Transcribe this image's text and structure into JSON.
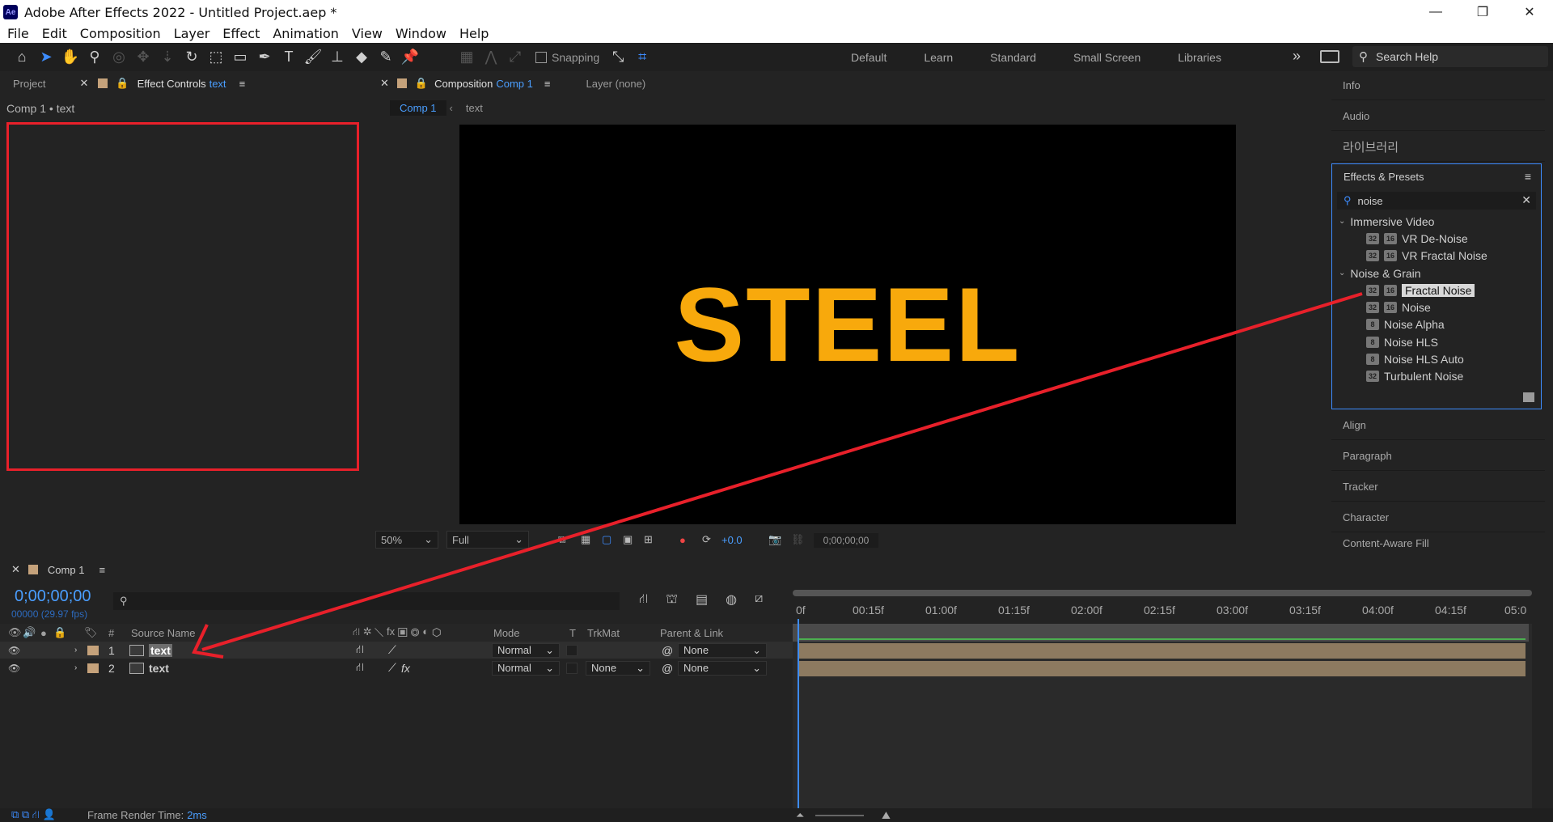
{
  "window": {
    "title": "Adobe After Effects 2022 - Untitled Project.aep *",
    "logo": "Ae",
    "minimize": "—",
    "restore": "❐",
    "close": "✕"
  },
  "menu": [
    "File",
    "Edit",
    "Composition",
    "Layer",
    "Effect",
    "Animation",
    "View",
    "Window",
    "Help"
  ],
  "toolbar": {
    "snapping_label": "Snapping",
    "workspaces": [
      "Default",
      "Learn",
      "Standard",
      "Small Screen",
      "Libraries"
    ],
    "search_help": "Search Help"
  },
  "left_panel": {
    "tab_project": "Project",
    "tab_effect_controls": "Effect Controls",
    "tab_effect_controls_target": "text",
    "breadcrumb": "Comp 1 • text"
  },
  "composition": {
    "tab_label": "Composition",
    "tab_comp": "Comp 1",
    "layer_tab": "Layer (none)",
    "subtab_comp": "Comp 1",
    "subtab_layer": "text",
    "canvas_text": "STEEL",
    "zoom": "50%",
    "resolution": "Full",
    "exposure": "+0.0",
    "timecode": "0;00;00;00"
  },
  "right_panel": {
    "info": "Info",
    "audio": "Audio",
    "library": "라이브러리",
    "effects_presets": "Effects & Presets",
    "search_value": "noise",
    "categories": [
      {
        "name": "Immersive Video",
        "items": [
          {
            "label": "VR De-Noise",
            "badges": [
              "32",
              "16"
            ]
          },
          {
            "label": "VR Fractal Noise",
            "badges": [
              "32",
              "16"
            ]
          }
        ]
      },
      {
        "name": "Noise & Grain",
        "items": [
          {
            "label": "Fractal Noise",
            "badges": [
              "32",
              "16"
            ]
          },
          {
            "label": "Noise",
            "badges": [
              "32",
              "16"
            ]
          },
          {
            "label": "Noise Alpha",
            "badges": [
              "8"
            ]
          },
          {
            "label": "Noise HLS",
            "badges": [
              "8"
            ]
          },
          {
            "label": "Noise HLS Auto",
            "badges": [
              "8"
            ]
          },
          {
            "label": "Turbulent Noise",
            "badges": [
              "32"
            ]
          }
        ]
      }
    ],
    "align": "Align",
    "paragraph": "Paragraph",
    "tracker": "Tracker",
    "character": "Character",
    "content_aware": "Content-Aware Fill"
  },
  "timeline": {
    "tab": "Comp 1",
    "timecode": "0;00;00;00",
    "timecode_sub": "00000 (29.97 fps)",
    "columns": {
      "hash": "#",
      "source_name": "Source Name",
      "mode": "Mode",
      "t": "T",
      "trkmat": "TrkMat",
      "parent": "Parent & Link"
    },
    "layers": [
      {
        "num": "1",
        "name": "text",
        "mode": "Normal",
        "trkmat": "",
        "parent": "None"
      },
      {
        "num": "2",
        "name": "text",
        "mode": "Normal",
        "trkmat": "None",
        "parent": "None"
      }
    ],
    "ruler_ticks": [
      "0f",
      "00:15f",
      "01:00f",
      "01:15f",
      "02:00f",
      "02:15f",
      "03:00f",
      "03:15f",
      "04:00f",
      "04:15f",
      "05:0"
    ]
  },
  "footer": {
    "label": "Frame Render Time:",
    "value": "2ms"
  },
  "colors": {
    "accent": "#3d8cff",
    "steel_text": "#f8a90c",
    "annotation": "#e8202a"
  }
}
